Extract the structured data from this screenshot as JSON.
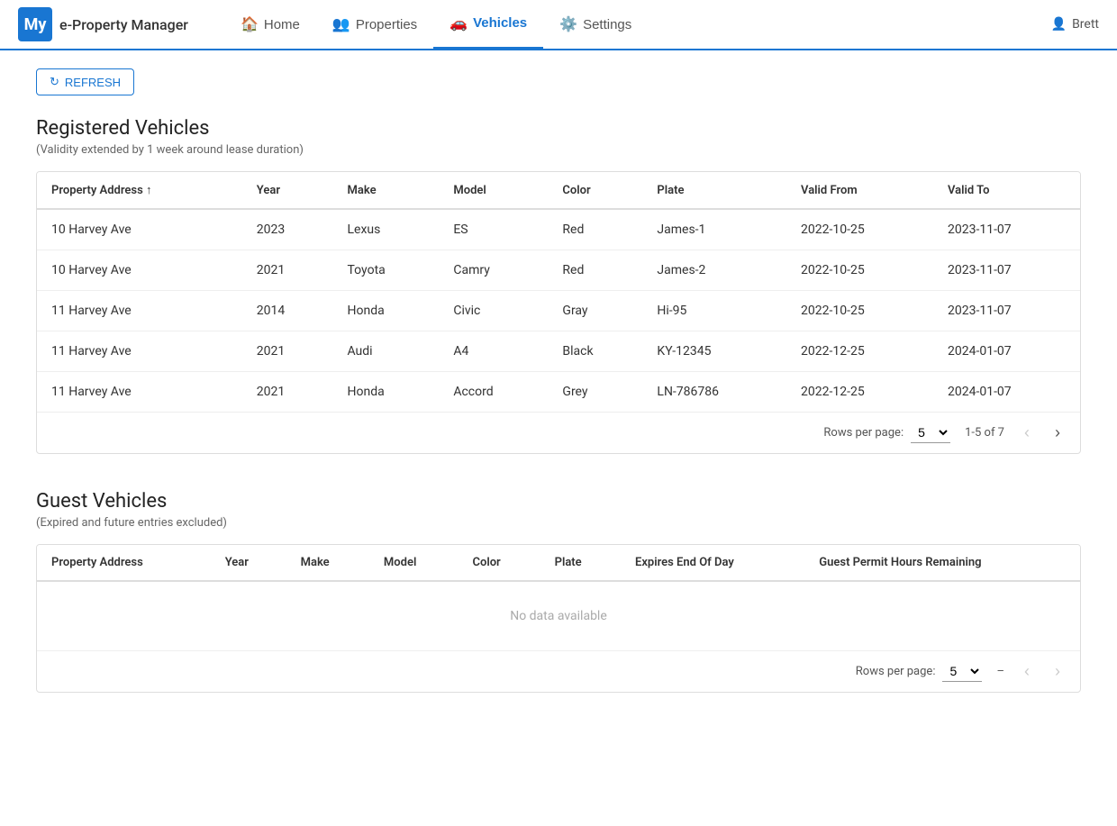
{
  "brand": {
    "badge": "My",
    "name": "e-Property Manager"
  },
  "nav": {
    "links": [
      {
        "id": "home",
        "label": "Home",
        "icon": "🏠",
        "active": false
      },
      {
        "id": "properties",
        "label": "Properties",
        "icon": "👥",
        "active": false
      },
      {
        "id": "vehicles",
        "label": "Vehicles",
        "icon": "🚗",
        "active": true
      },
      {
        "id": "settings",
        "label": "Settings",
        "icon": "⚙️",
        "active": false
      }
    ],
    "user": "Brett"
  },
  "refresh_button": "REFRESH",
  "registered_vehicles": {
    "title": "Registered Vehicles",
    "subtitle": "(Validity extended by 1 week around lease duration)",
    "columns": [
      {
        "id": "address",
        "label": "Property Address",
        "sortable": true
      },
      {
        "id": "year",
        "label": "Year",
        "sortable": false
      },
      {
        "id": "make",
        "label": "Make",
        "sortable": false
      },
      {
        "id": "model",
        "label": "Model",
        "sortable": false
      },
      {
        "id": "color",
        "label": "Color",
        "sortable": false
      },
      {
        "id": "plate",
        "label": "Plate",
        "sortable": false
      },
      {
        "id": "valid_from",
        "label": "Valid From",
        "sortable": false
      },
      {
        "id": "valid_to",
        "label": "Valid To",
        "sortable": false
      }
    ],
    "rows": [
      {
        "address": "10 Harvey Ave",
        "year": "2023",
        "make": "Lexus",
        "model": "ES",
        "color": "Red",
        "plate": "James-1",
        "valid_from": "2022-10-25",
        "valid_to": "2023-11-07"
      },
      {
        "address": "10 Harvey Ave",
        "year": "2021",
        "make": "Toyota",
        "model": "Camry",
        "color": "Red",
        "plate": "James-2",
        "valid_from": "2022-10-25",
        "valid_to": "2023-11-07"
      },
      {
        "address": "11 Harvey Ave",
        "year": "2014",
        "make": "Honda",
        "model": "Civic",
        "color": "Gray",
        "plate": "Hi-95",
        "valid_from": "2022-10-25",
        "valid_to": "2023-11-07"
      },
      {
        "address": "11 Harvey Ave",
        "year": "2021",
        "make": "Audi",
        "model": "A4",
        "color": "Black",
        "plate": "KY-12345",
        "valid_from": "2022-12-25",
        "valid_to": "2024-01-07"
      },
      {
        "address": "11 Harvey Ave",
        "year": "2021",
        "make": "Honda",
        "model": "Accord",
        "color": "Grey",
        "plate": "LN-786786",
        "valid_from": "2022-12-25",
        "valid_to": "2024-01-07"
      }
    ],
    "pagination": {
      "rows_per_page_label": "Rows per page:",
      "rows_per_page_value": "5",
      "page_info": "1-5 of 7"
    }
  },
  "guest_vehicles": {
    "title": "Guest Vehicles",
    "subtitle": "(Expired and future entries excluded)",
    "columns": [
      {
        "id": "address",
        "label": "Property Address"
      },
      {
        "id": "year",
        "label": "Year"
      },
      {
        "id": "make",
        "label": "Make"
      },
      {
        "id": "model",
        "label": "Model"
      },
      {
        "id": "color",
        "label": "Color"
      },
      {
        "id": "plate",
        "label": "Plate"
      },
      {
        "id": "expires",
        "label": "Expires End Of Day"
      },
      {
        "id": "permit_hours",
        "label": "Guest Permit Hours Remaining"
      }
    ],
    "no_data": "No data available",
    "pagination": {
      "rows_per_page_label": "Rows per page:",
      "rows_per_page_value": "5",
      "page_info": "–"
    }
  }
}
